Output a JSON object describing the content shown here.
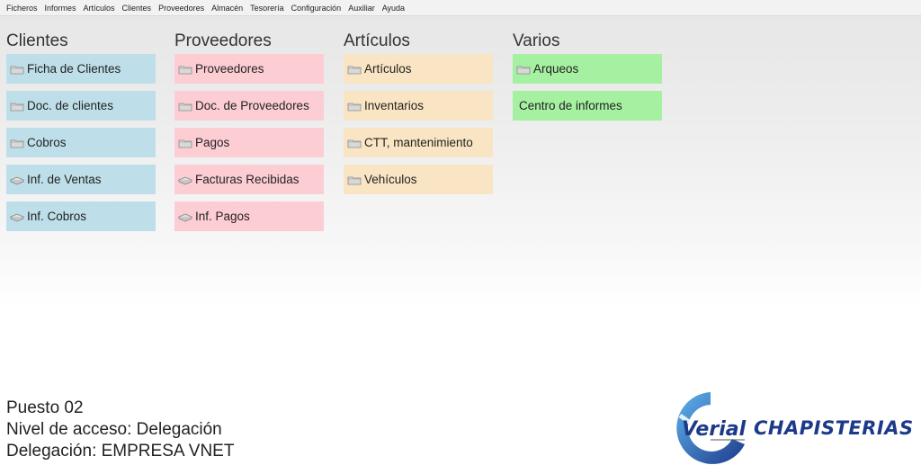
{
  "menu": [
    "Ficheros",
    "Informes",
    "Artículos",
    "Clientes",
    "Proveedores",
    "Almacén",
    "Tesorería",
    "Configuración",
    "Auxiliar",
    "Ayuda"
  ],
  "columns": {
    "clientes": {
      "title": "Clientes",
      "color": "#bedfe9",
      "items": [
        {
          "label": "Ficha de Clientes",
          "icon": "folder-icon"
        },
        {
          "label": "Doc. de clientes",
          "icon": "folder-icon"
        },
        {
          "label": "Cobros",
          "icon": "folder-icon"
        },
        {
          "label": "Inf. de Ventas",
          "icon": "report-icon"
        },
        {
          "label": "Inf. Cobros",
          "icon": "report-icon"
        }
      ]
    },
    "proveedores": {
      "title": "Proveedores",
      "color": "#fdcdd4",
      "items": [
        {
          "label": "Proveedores",
          "icon": "folder-icon"
        },
        {
          "label": "Doc. de Proveedores",
          "icon": "folder-icon"
        },
        {
          "label": "Pagos",
          "icon": "folder-icon"
        },
        {
          "label": "Facturas Recibidas",
          "icon": "report-icon"
        },
        {
          "label": "Inf. Pagos",
          "icon": "report-icon"
        }
      ]
    },
    "articulos": {
      "title": "Artículos",
      "color": "#f9e5c3",
      "items": [
        {
          "label": "Artículos",
          "icon": "folder-icon"
        },
        {
          "label": "Inventarios",
          "icon": "folder-icon"
        },
        {
          "label": "CTT, mantenimiento",
          "icon": "folder-icon"
        },
        {
          "label": "Vehículos",
          "icon": "folder-icon"
        }
      ]
    },
    "varios": {
      "title": "Varios",
      "color": "#a5f1a1",
      "items": [
        {
          "label": "Arqueos",
          "icon": "folder-icon"
        },
        {
          "label": "Centro de informes",
          "icon": ""
        }
      ]
    }
  },
  "footer": {
    "puesto": "Puesto 02",
    "nivel": "Nivel de acceso: Delegación",
    "delegacion": "Delegación: EMPRESA VNET"
  },
  "brand": {
    "logo_text": "Verial",
    "product": "CHAPISTERIAS",
    "primary_color": "#1d3a8a",
    "accent_color": "#2a8fd6"
  }
}
